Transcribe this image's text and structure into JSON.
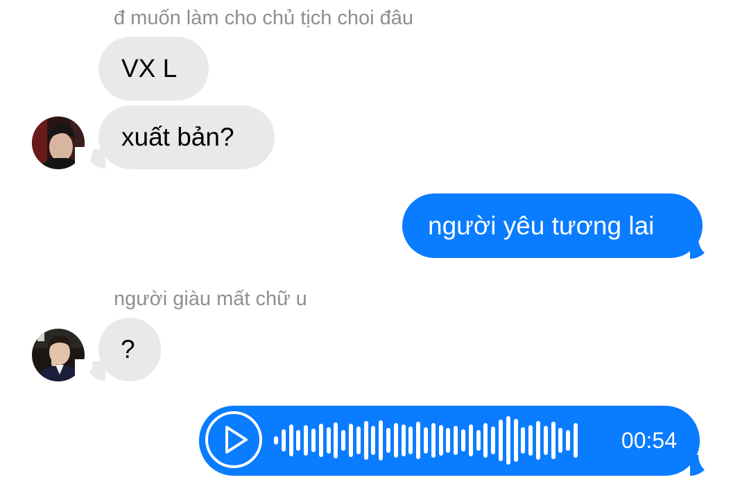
{
  "messages": [
    {
      "sender": "đ muốn làm cho chủ tịch choi đâu",
      "text": "VX L"
    },
    {
      "text": "xuất bản?"
    },
    {
      "text": "người yêu tương lai"
    },
    {
      "sender": "người giàu mất chữ u",
      "text": "?"
    }
  ],
  "voice_message": {
    "duration": "00:54",
    "play_icon": "play-icon",
    "progress": 0
  },
  "colors": {
    "outgoing_bubble": "#0a7cff",
    "incoming_bubble": "#e9e9eb",
    "sender_name": "#8e8e93"
  }
}
